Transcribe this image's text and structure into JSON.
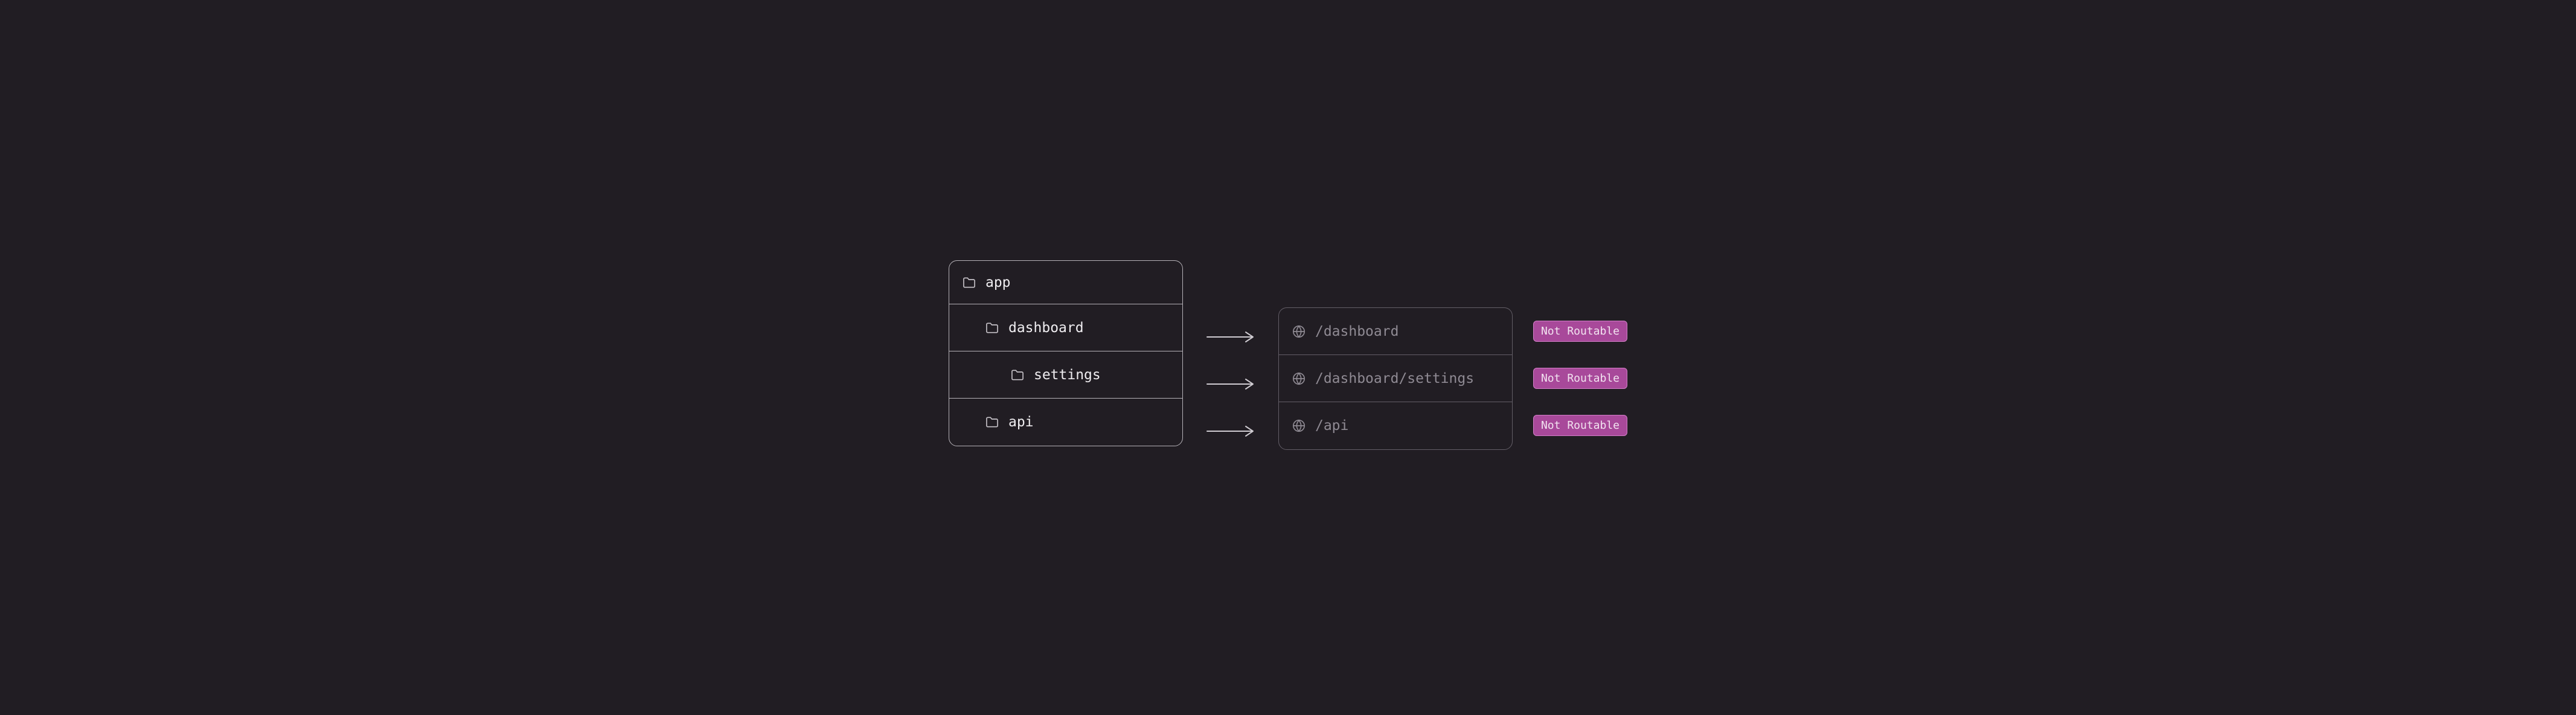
{
  "colors": {
    "background": "#211d23",
    "panel_border_bright": "#b6b2b8",
    "panel_border_dim": "#635e67",
    "text_bright": "#efedf0",
    "text_dim": "#8f8a93",
    "badge_bg": "#a8499a",
    "badge_border": "#d37fc8",
    "badge_text": "#f2e4f0"
  },
  "tree": {
    "root": "app",
    "children": [
      {
        "name": "dashboard",
        "depth": 1
      },
      {
        "name": "settings",
        "depth": 2
      },
      {
        "name": "api",
        "depth": 1
      }
    ]
  },
  "routes": [
    {
      "path": "/dashboard",
      "badge": "Not Routable"
    },
    {
      "path": "/dashboard/settings",
      "badge": "Not Routable"
    },
    {
      "path": "/api",
      "badge": "Not Routable"
    }
  ]
}
